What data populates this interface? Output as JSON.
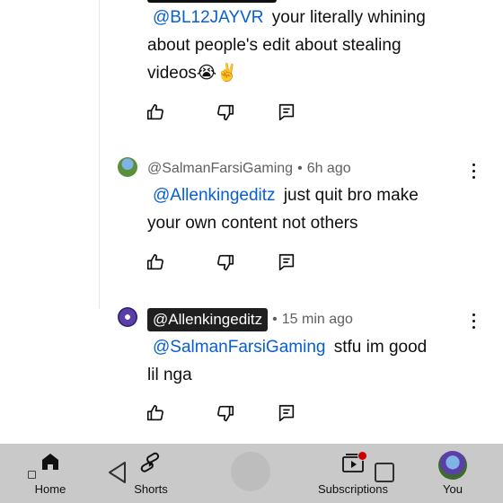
{
  "comments": [
    {
      "mention": "@BL12JAYVR",
      "text_line1": "your literally whining",
      "text_line2": "about people's edit about stealing",
      "text_line3": "videos😭✌️"
    },
    {
      "author": "@SalmanFarsiGaming",
      "separator": "•",
      "time": "6h ago",
      "mention": "@Allenkingeditz",
      "text_line1": "just quit bro make",
      "text_line2": "your own content not others"
    },
    {
      "author": "@Allenkingeditz",
      "separator": "•",
      "time": "15 min ago",
      "mention": "@SalmanFarsiGaming",
      "text_line1": "stfu im good",
      "text_line2": "lil nga"
    }
  ],
  "icons": {
    "like": "thumbs-up-icon",
    "dislike": "thumbs-down-icon",
    "reply": "reply-icon",
    "more": "more-vert-icon"
  },
  "nav": {
    "home": "Home",
    "shorts": "Shorts",
    "subscriptions": "Subscriptions",
    "you": "You"
  },
  "colors": {
    "mention": "#065fd4",
    "meta_text": "#606060",
    "navbar_bg": "#c9c9c9",
    "notification": "#cc0000"
  }
}
